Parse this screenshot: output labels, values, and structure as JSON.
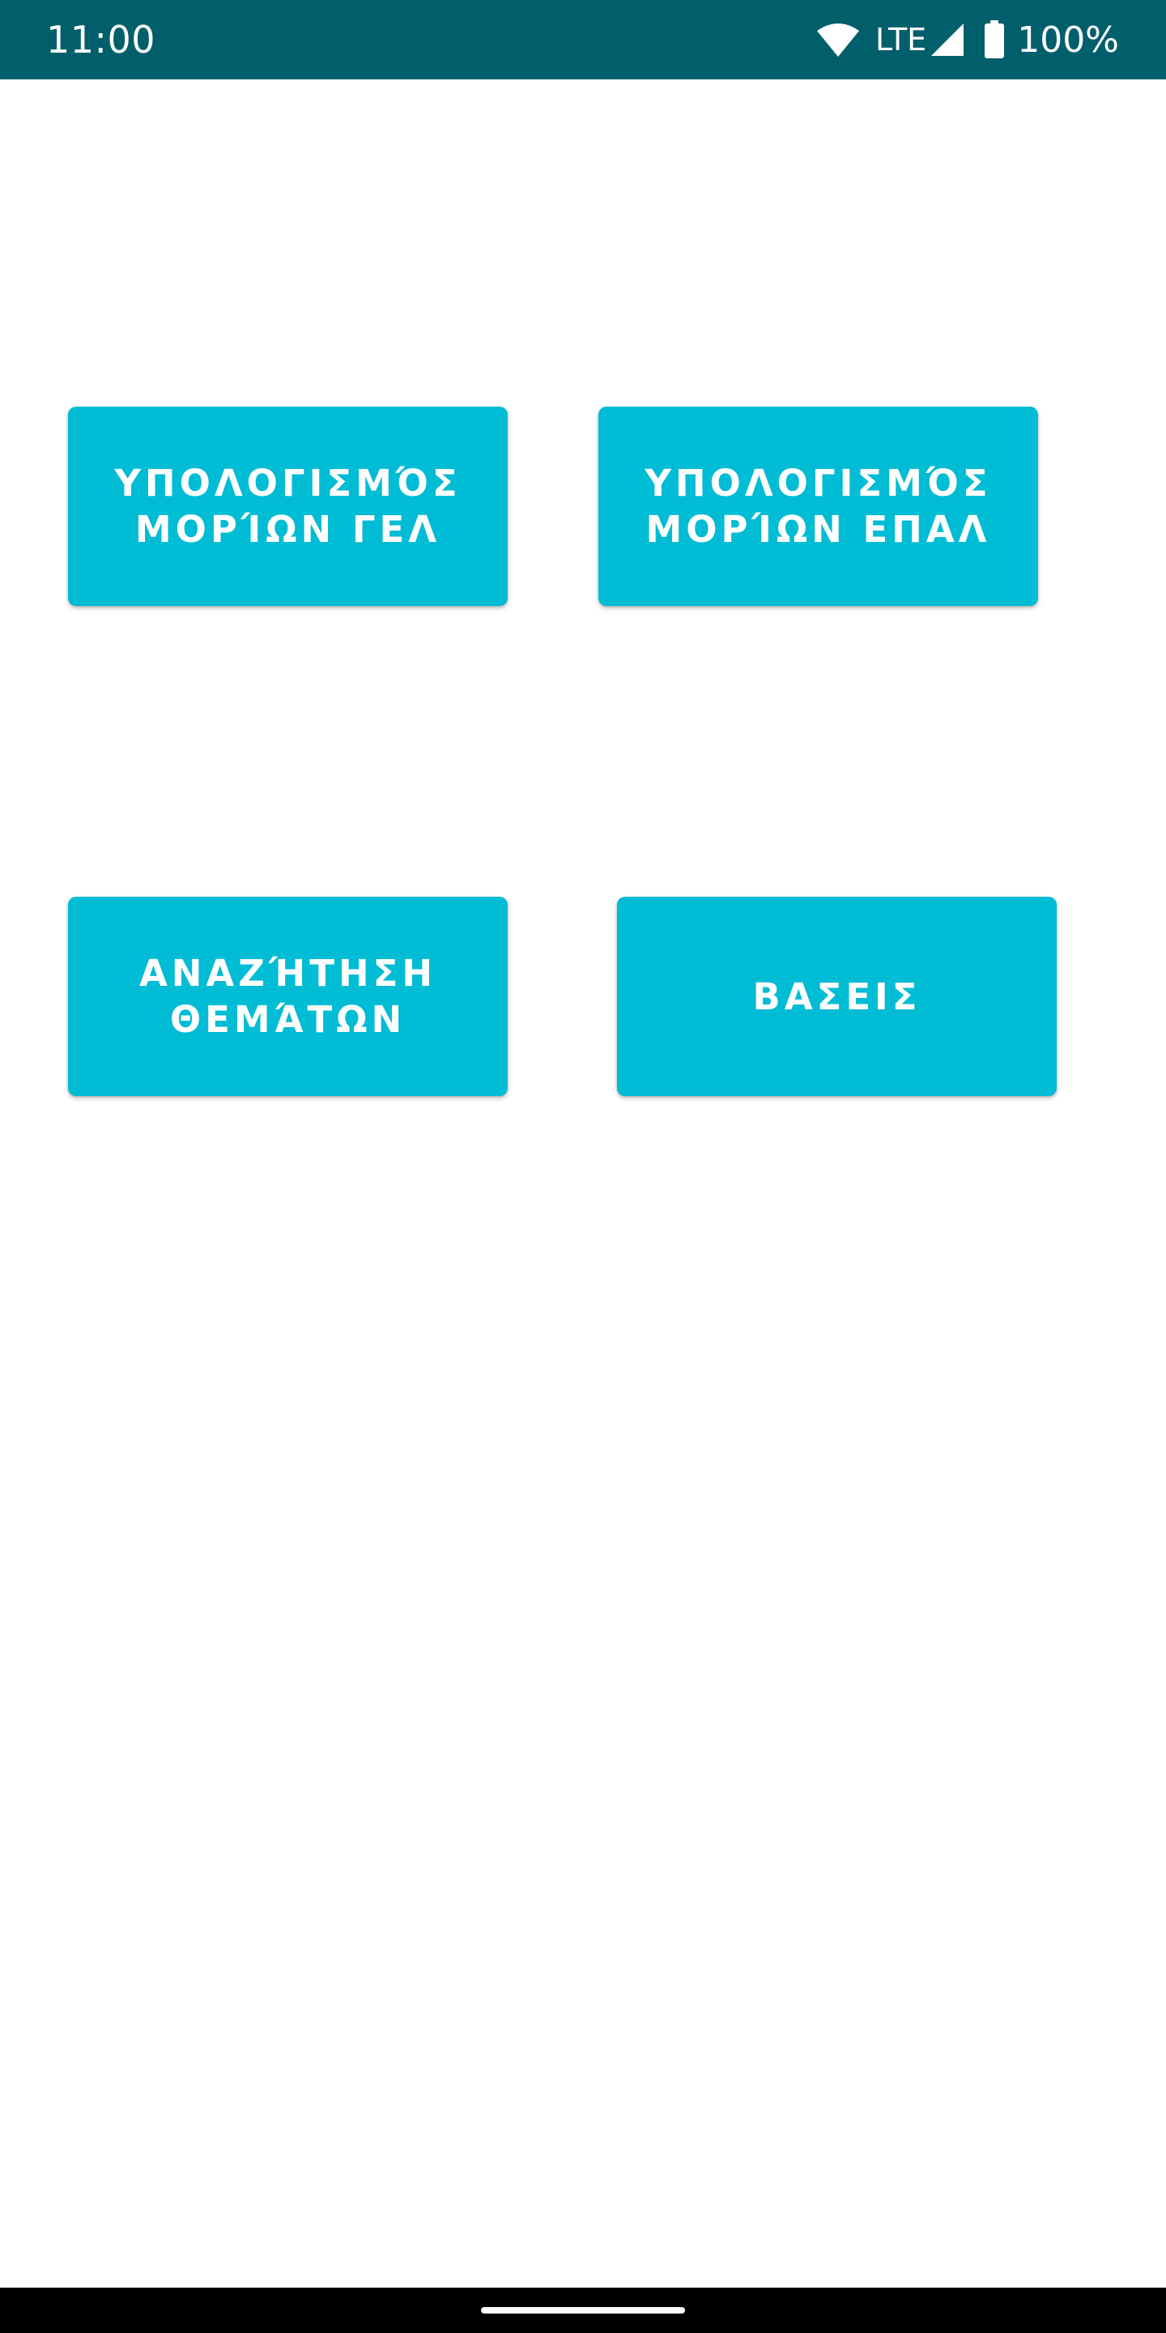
{
  "status_bar": {
    "time": "11:00",
    "network": "LTE",
    "battery": "100%",
    "icons": [
      "wifi-icon",
      "signal-icon",
      "battery-icon"
    ]
  },
  "main": {
    "buttons": [
      {
        "label": "ΥΠΟΛΟΓΙΣΜΌΣ\nΜΟΡΊΩΝ ΓΕΛ"
      },
      {
        "label": "ΥΠΟΛΟΓΙΣΜΌΣ\nΜΟΡΊΩΝ ΕΠΑΛ"
      },
      {
        "label": "ΑΝΑΖΉΤΗΣΗ\nΘΕΜΆΤΩΝ"
      },
      {
        "label": "ΒΑΣΕΙΣ"
      }
    ]
  },
  "colors": {
    "status_bar": "#005f6b",
    "button": "#00bcd4",
    "button_text": "#ffffff",
    "background": "#ffffff",
    "nav_bar": "#000000"
  }
}
